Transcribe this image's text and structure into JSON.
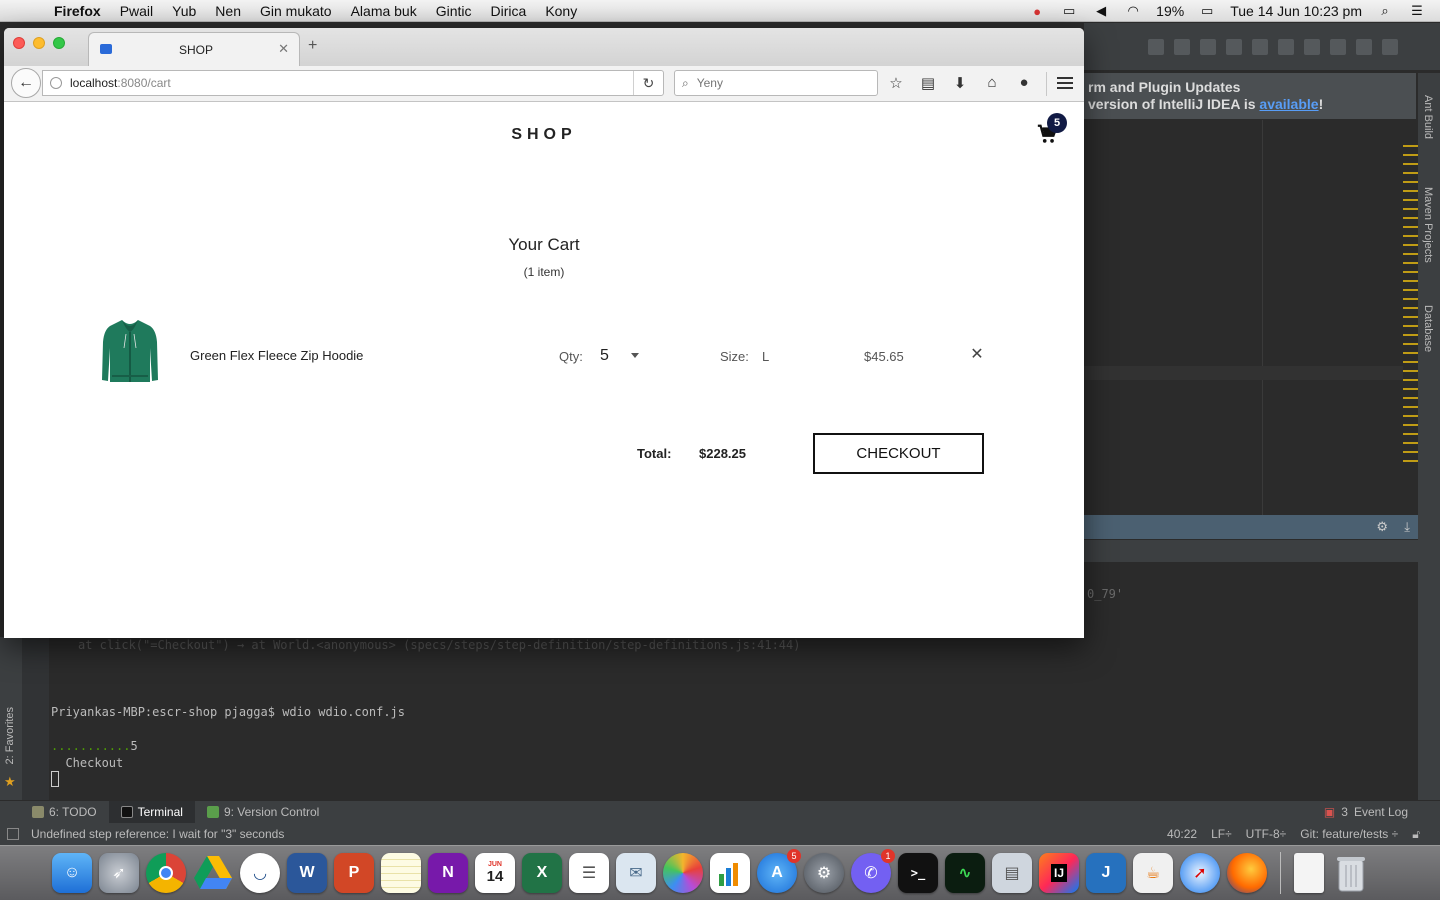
{
  "menubar": {
    "app": "Firefox",
    "items": [
      "Pwail",
      "Yub",
      "Nen",
      "Gin mukato",
      "Alama buk",
      "Gintic",
      "Dirica",
      "Kony"
    ],
    "battery": "19%",
    "datetime": "Tue 14 Jun  10:23 pm"
  },
  "browser": {
    "tab_title": "SHOP",
    "url_host": "localhost",
    "url_rest": ":8080/cart",
    "search_placeholder": "Yeny"
  },
  "shop": {
    "logo": "SHOP",
    "cart_badge": "5",
    "cart_title": "Your Cart",
    "cart_count": "(1 item)",
    "items": [
      {
        "name": "Green Flex Fleece Zip Hoodie",
        "qty_label": "Qty:",
        "qty": "5",
        "size_label": "Size:",
        "size": "L",
        "price": "$45.65"
      }
    ],
    "total_label": "Total:",
    "total_value": "$228.25",
    "checkout_label": "CHECKOUT",
    "colors": {
      "accent": "#111a44",
      "hoodie": "#1f7a5c"
    }
  },
  "ide": {
    "notice_line1": "rm and Plugin Updates",
    "notice_line2": "version of IntelliJ IDEA is",
    "notice_link": "available",
    "notice_end": "!",
    "right_tabs": [
      "Ant Build",
      "Maven Projects",
      "Database"
    ],
    "left_tab": "2: Favorites",
    "terminal_faded": "at click(\"=Checkout\") → at World.<anonymous> (specs/steps/step-definition/step-definitions.js:41:44)",
    "terminal_right": "0_79'",
    "terminal_prompt": "Priyankas-MBP:escr-shop pjagga$ wdio wdio.conf.js",
    "terminal_dots": "...........",
    "terminal_count": "5",
    "terminal_checkout": "  Checkout",
    "tool_tabs": [
      "6: TODO",
      "Terminal",
      "9: Version Control"
    ],
    "event_log": "Event Log",
    "event_count": "3",
    "status_message": "Undefined step reference: I wait for \"3\" seconds",
    "status_pos": "40:22",
    "status_lf": "LF÷",
    "status_enc": "UTF-8÷",
    "status_git": "Git: feature/tests ÷"
  },
  "dock": {
    "badges": {
      "appstore": "5",
      "viber": "1"
    },
    "calendar_day": "14",
    "calendar_month": "JUN"
  }
}
